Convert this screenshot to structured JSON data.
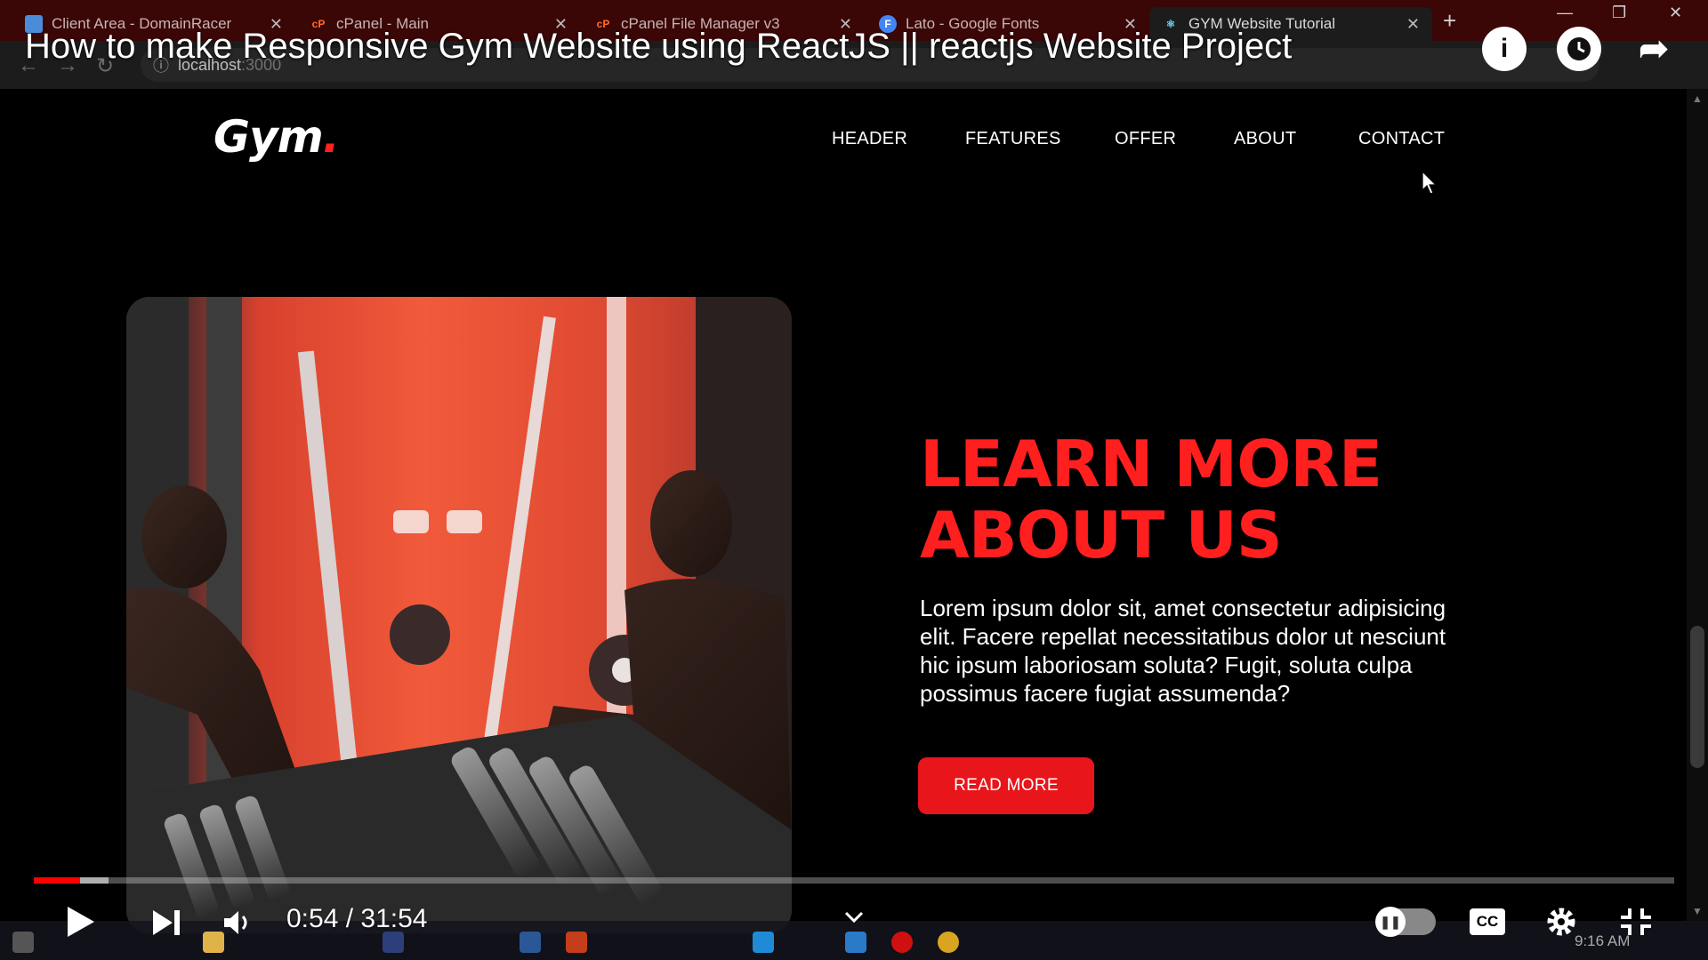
{
  "browser": {
    "tabs": [
      {
        "label": "Client Area - DomainRacer",
        "favicon": "shield-icon",
        "favicon_color": "#4b8cd8"
      },
      {
        "label": "cPanel - Main",
        "favicon": "cpanel-icon",
        "favicon_color": "#ff6c2c"
      },
      {
        "label": "cPanel File Manager v3",
        "favicon": "cpanel-icon",
        "favicon_color": "#ff6c2c"
      },
      {
        "label": "Lato - Google Fonts",
        "favicon": "google-fonts-icon",
        "favicon_color": "#4285f4",
        "favicon_glyph": "F"
      },
      {
        "label": "GYM Website Tutorial",
        "favicon": "react-icon",
        "favicon_color": "#61dafb"
      }
    ],
    "new_tab": "+",
    "address": {
      "host": "localhost",
      "port": ":3000"
    }
  },
  "video": {
    "title": "How to make Responsive Gym Website using ReactJS || reactjs Website Project",
    "current_time": "0:54",
    "separator": " / ",
    "duration": "31:54",
    "progress_fraction": 0.028
  },
  "site": {
    "logo_text": "Gym",
    "logo_dot": ".",
    "nav": [
      "HEADER",
      "FEATURES",
      "OFFER",
      "ABOUT",
      "CONTACT"
    ],
    "about": {
      "title": "LEARN MORE ABOUT US",
      "body": "Lorem ipsum dolor sit, amet consectetur adipisicing elit. Facere repellat necessitatibus dolor ut nesciunt hic ipsum laboriosam soluta? Fugit, soluta culpa possimus facere fugiat assumenda?",
      "button": "READ MORE"
    },
    "colors": {
      "accent": "#ff1f1f",
      "background": "#000000"
    }
  },
  "taskbar": {
    "clock": "9:16 AM"
  }
}
